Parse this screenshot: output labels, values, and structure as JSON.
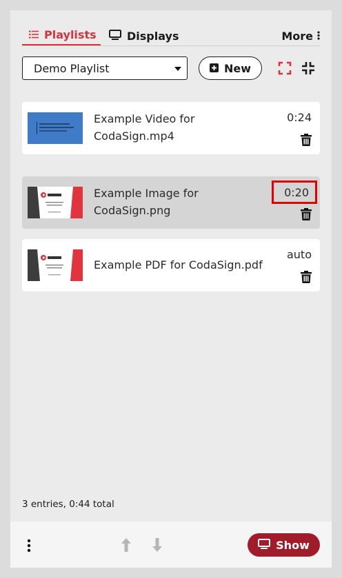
{
  "tabs": {
    "playlists": "Playlists",
    "displays": "Displays",
    "more": "More"
  },
  "toolbar": {
    "selected_playlist": "Demo Playlist",
    "new_label": "New"
  },
  "entries": [
    {
      "title": "Example Video for CodaSign.mp4",
      "duration": "0:24",
      "thumb": "video-thumbnail"
    },
    {
      "title": "Example Image for CodaSign.png",
      "duration": "0:20",
      "thumb": "codasign-thumbnail",
      "selected": true
    },
    {
      "title": "Example PDF for CodaSign.pdf",
      "duration": "auto",
      "thumb": "codasign-thumbnail"
    }
  ],
  "summary": "3 entries, 0:44 total",
  "footer": {
    "show_label": "Show"
  },
  "colors": {
    "accent": "#d8323e",
    "show_button": "#a11c2b",
    "highlight_box": "#e00000"
  }
}
